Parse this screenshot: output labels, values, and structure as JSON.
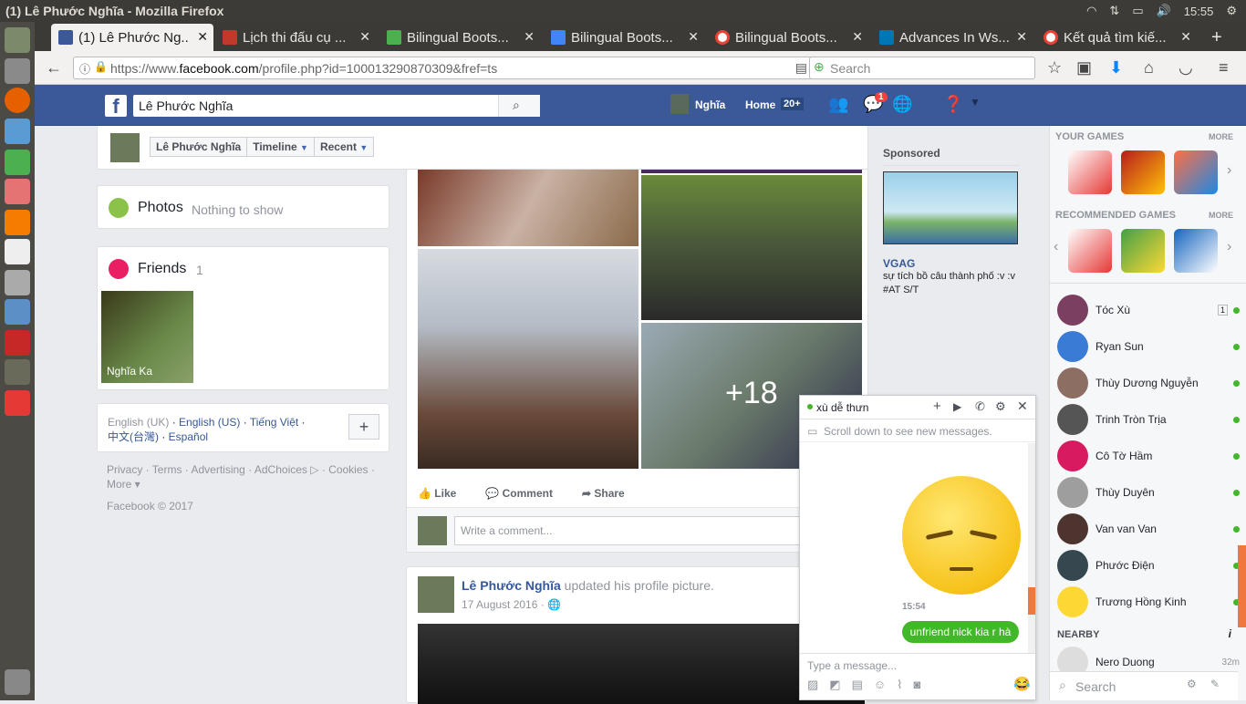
{
  "os_bar": {
    "window_title": "(1) Lê Phước Nghĩa - Mozilla Firefox",
    "time": "15:55"
  },
  "tabs": [
    {
      "label": "(1) Lê Phước Ng...",
      "color": "#3b5998"
    },
    {
      "label": "Lịch thi đấu cụ ...",
      "color": "#c0392b"
    },
    {
      "label": "Bilingual Boots...",
      "color": "#4caf50"
    },
    {
      "label": "Bilingual Boots...",
      "color": "#4285f4"
    },
    {
      "label": "Bilingual Boots...",
      "color": "#ea4335"
    },
    {
      "label": "Advances In Ws...",
      "color": "#0077b5"
    },
    {
      "label": "Kết quả tìm kiế...",
      "color": "#ea4335"
    }
  ],
  "nav": {
    "url_prefix": "https://www.",
    "url_domain": "facebook.com",
    "url_rest": "/profile.php?id=100013290870309&fref=ts",
    "search_placeholder": "Search"
  },
  "fb_header": {
    "search_value": "Lê Phước Nghĩa",
    "user": "Nghĩa",
    "home": "Home",
    "home_count": "20+",
    "messages_badge": "1"
  },
  "profile_nav": {
    "name": "Lê Phước Nghĩa",
    "timeline": "Timeline",
    "recent": "Recent"
  },
  "photos_card": {
    "title": "Photos",
    "subtitle": "Nothing to show"
  },
  "friends_card": {
    "title": "Friends",
    "count": "1",
    "friend_name": "Nghĩa Ka"
  },
  "languages": {
    "current": "English (UK)",
    "links": [
      "English (US)",
      "Tiếng Việt",
      "中文(台灣)",
      "Español"
    ],
    "add": "+"
  },
  "footer": {
    "links": [
      "Privacy",
      "Terms",
      "Advertising",
      "AdChoices",
      "Cookies",
      "More"
    ],
    "copyright": "Facebook © 2017"
  },
  "post": {
    "more_count": "+18",
    "like": "Like",
    "comment": "Comment",
    "share": "Share",
    "comment_placeholder": "Write a comment..."
  },
  "post2": {
    "author": "Lê Phước Nghĩa",
    "action": "updated his profile picture.",
    "date": "17 August 2016"
  },
  "sponsored": {
    "label": "Sponsored",
    "source": "VGAG",
    "text": "sự tích bồ câu thành phố :v :v #AT S/T"
  },
  "games": {
    "your_games": "YOUR GAMES",
    "recommended": "RECOMMENDED GAMES",
    "more": "MORE"
  },
  "contacts": [
    {
      "name": "Tóc Xù",
      "badge": "1",
      "color": "#7b3f61"
    },
    {
      "name": "Ryan Sun",
      "color": "#3a7bd5"
    },
    {
      "name": "Thùy Dương Nguyễn",
      "color": "#8d6e63"
    },
    {
      "name": "Trinh Tròn Trịa",
      "color": "#555"
    },
    {
      "name": "Cô Tờ Hầm",
      "color": "#d81b60"
    },
    {
      "name": "Thùy Duyên",
      "color": "#9e9e9e"
    },
    {
      "name": "Van van Van",
      "color": "#4e342e"
    },
    {
      "name": "Phước Điện",
      "color": "#37474f"
    },
    {
      "name": "Trương Hồng Kinh",
      "color": "#fdd835"
    }
  ],
  "nearby": {
    "label": "NEARBY",
    "name": "Nero Duong",
    "time": "32m"
  },
  "sidebar_search": "Search",
  "chat": {
    "name": "xù dễ thưn",
    "notice": "Scroll down to see new messages.",
    "time": "15:54",
    "message": "unfriend nick kia r hà",
    "placeholder": "Type a message..."
  }
}
